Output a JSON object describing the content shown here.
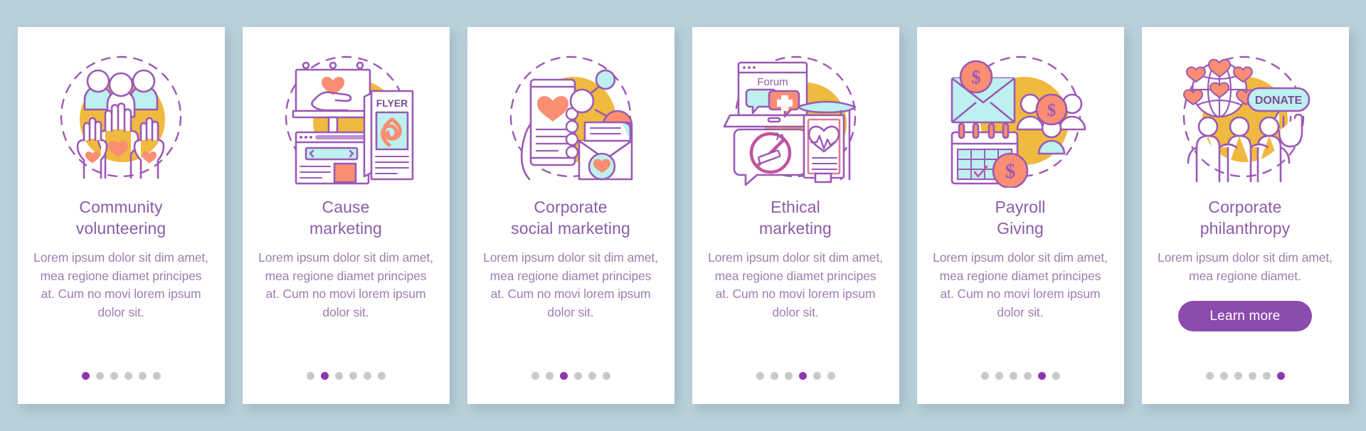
{
  "page": {
    "background_color": "#b9cfd9",
    "card_background": "#ffffff",
    "title_color": "#8d5ba8",
    "body_color": "#9d7eb0",
    "accent_color": "#8c4bae",
    "dot_active_color": "#8c36ad",
    "dot_inactive_color": "#c9c9c9",
    "illustration_blob_color": "#f0b93f",
    "illustration_line_color": "#9b59b6",
    "illustration_coral_color": "#fa8e72",
    "illustration_mint_color": "#bdf0ef"
  },
  "cards": [
    {
      "title": "Community\nvolunteering",
      "body": "Lorem ipsum dolor sit dim amet, mea regione diamet principes at. Cum no movi lorem ipsum dolor sit.",
      "illustration": "community-volunteering-illustration",
      "active_dot": 0,
      "dot_count": 6,
      "cta": null
    },
    {
      "title": "Cause\nmarketing",
      "body": "Lorem ipsum dolor sit dim amet, mea regione diamet principes at. Cum no movi lorem ipsum dolor sit.",
      "illustration": "cause-marketing-illustration",
      "illustration_labels": [
        "FLYER"
      ],
      "active_dot": 1,
      "dot_count": 6,
      "cta": null
    },
    {
      "title": "Corporate\nsocial marketing",
      "body": "Lorem ipsum dolor sit dim amet, mea regione diamet principes at. Cum no movi lorem ipsum dolor sit.",
      "illustration": "corporate-social-marketing-illustration",
      "active_dot": 2,
      "dot_count": 6,
      "cta": null
    },
    {
      "title": "Ethical\nmarketing",
      "body": "Lorem ipsum dolor sit dim amet, mea regione diamet principes at. Cum no movi lorem ipsum dolor sit.",
      "illustration": "ethical-marketing-illustration",
      "illustration_labels": [
        "Forum"
      ],
      "active_dot": 3,
      "dot_count": 6,
      "cta": null
    },
    {
      "title": "Payroll\nGiving",
      "body": "Lorem ipsum dolor sit dim amet, mea regione diamet principes at. Cum no movi lorem ipsum dolor sit.",
      "illustration": "payroll-giving-illustration",
      "active_dot": 4,
      "dot_count": 6,
      "cta": null
    },
    {
      "title": "Corporate\nphilanthropy",
      "body": "Lorem ipsum dolor sit dim amet, mea regione diamet.",
      "illustration": "corporate-philanthropy-illustration",
      "illustration_labels": [
        "DONATE"
      ],
      "active_dot": 5,
      "dot_count": 6,
      "cta": "Learn more"
    }
  ]
}
